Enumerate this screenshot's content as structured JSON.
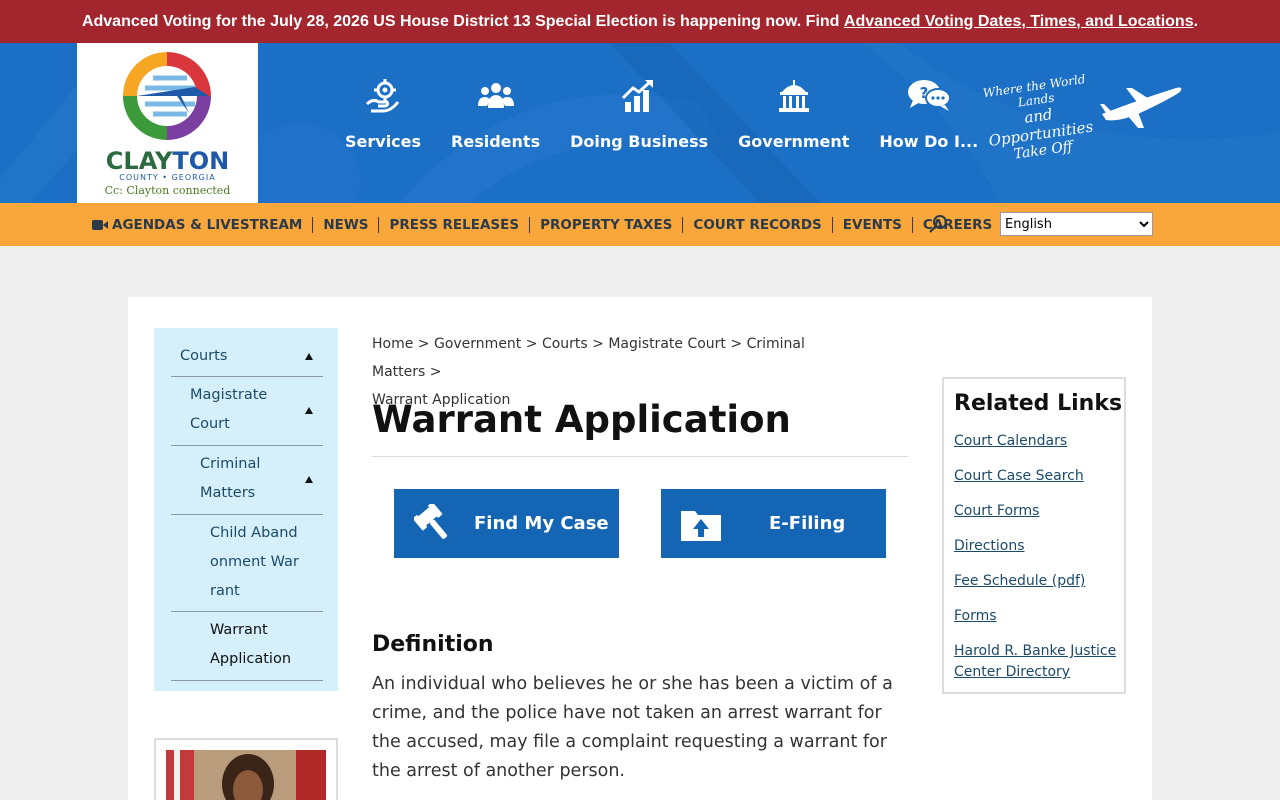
{
  "alert": {
    "text": "Advanced Voting for the July 28, 2026 US House District 13 Special Election is happening now. Find ",
    "link": "Advanced Voting Dates, Times, and Locations",
    "suffix": "."
  },
  "logo": {
    "name_part1": "CLAY",
    "name_part2": "TON",
    "sub": "COUNTY • GEORGIA",
    "tagline": "Cc: Clayton connected"
  },
  "main_nav": [
    {
      "label": "Services",
      "icon": "hand-gear-icon"
    },
    {
      "label": "Residents",
      "icon": "people-icon"
    },
    {
      "label": "Doing Business",
      "icon": "chart-icon"
    },
    {
      "label": "Government",
      "icon": "capitol-icon"
    },
    {
      "label": "How Do I...",
      "icon": "question-bubble-icon"
    }
  ],
  "slogan": {
    "line1": "Where the World Lands",
    "line2": "and Opportunities",
    "line3": "Take Off"
  },
  "sub_nav": [
    "AGENDAS & LIVESTREAM",
    "NEWS",
    "PRESS RELEASES",
    "PROPERTY TAXES",
    "COURT RECORDS",
    "EVENTS",
    "CAREERS"
  ],
  "language": {
    "selected": "English"
  },
  "side_nav": {
    "courts": "Courts",
    "magistrate": "Magistrate Court",
    "criminal": "Criminal Matters",
    "child": "Child Abandonment Warrant",
    "warrant": "Warrant Application"
  },
  "breadcrumb": {
    "home": "Home",
    "government": "Government",
    "courts": "Courts",
    "magistrate": "Magistrate Court",
    "criminal": "Criminal Matters",
    "current": "Warrant Application",
    "sep": " > "
  },
  "page": {
    "title": "Warrant Application",
    "find_case": "Find My Case",
    "efiling": "E-Filing",
    "definition_heading": "Definition",
    "definition_text": "An individual who believes he or she has been a victim of a crime, and the police have not taken an arrest warrant for the accused, may file a complaint requesting a warrant for the arrest of another person."
  },
  "related": {
    "heading": "Related Links",
    "links": [
      "Court Calendars",
      "Court Case Search",
      "Court Forms",
      "Directions",
      "Fee Schedule (pdf)",
      "Forms",
      "Harold R. Banke Justice Center Directory"
    ]
  }
}
